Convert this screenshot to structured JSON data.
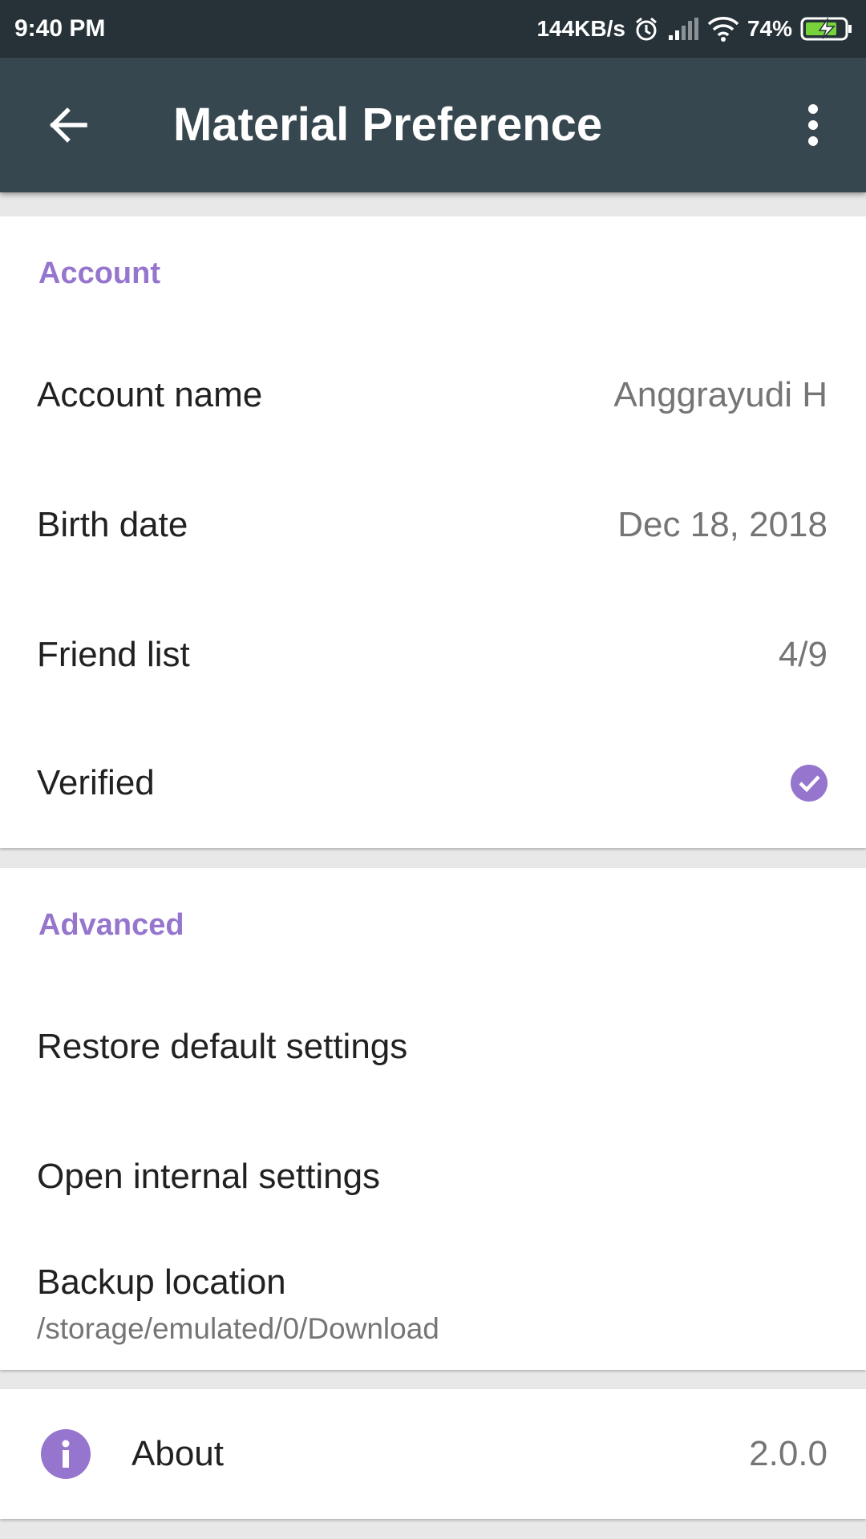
{
  "status_bar": {
    "time": "9:40 PM",
    "network_speed": "144KB/s",
    "battery_percent": "74%",
    "icons": [
      "alarm-icon",
      "signal-icon",
      "wifi-icon",
      "battery-charging-icon"
    ]
  },
  "toolbar": {
    "title": "Material Preference",
    "back_icon": "arrow-back-icon",
    "menu_icon": "more-vert-icon",
    "background": "#37474f"
  },
  "account_section": {
    "header": "Account",
    "items": [
      {
        "title": "Account name",
        "value": "Anggrayudi H"
      },
      {
        "title": "Birth date",
        "value": "Dec 18, 2018"
      },
      {
        "title": "Friend list",
        "value": "4/9"
      },
      {
        "title": "Verified",
        "checked": true
      }
    ]
  },
  "advanced_section": {
    "header": "Advanced",
    "items": [
      {
        "title": "Restore default settings"
      },
      {
        "title": "Open internal settings"
      },
      {
        "title": "Backup location",
        "summary": "/storage/emulated/0/Download"
      }
    ]
  },
  "about": {
    "title": "About",
    "value": "2.0.0",
    "icon": "info-icon"
  },
  "colors": {
    "accent": "#9575cd",
    "status_bar": "#263238",
    "battery_charge": "#76d33a"
  }
}
